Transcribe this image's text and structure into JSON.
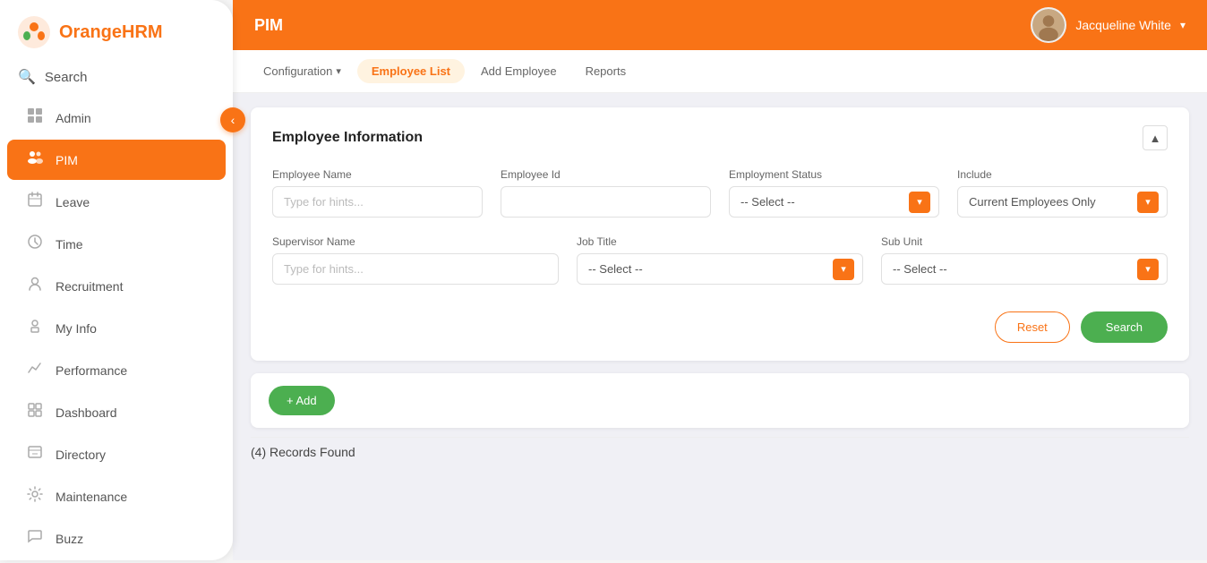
{
  "app": {
    "name": "OrangeHRM",
    "name_orange": "Orange",
    "name_hrm": "HRM"
  },
  "header": {
    "title": "PIM",
    "user_name": "Jacqueline White",
    "user_avatar": "👩"
  },
  "tabs": {
    "items": [
      {
        "id": "configuration",
        "label": "Configuration",
        "has_dropdown": true,
        "active": false
      },
      {
        "id": "employee-list",
        "label": "Employee List",
        "has_dropdown": false,
        "active": true
      },
      {
        "id": "add-employee",
        "label": "Add Employee",
        "has_dropdown": false,
        "active": false
      },
      {
        "id": "reports",
        "label": "Reports",
        "has_dropdown": false,
        "active": false
      }
    ]
  },
  "sidebar": {
    "search_label": "Search",
    "items": [
      {
        "id": "admin",
        "label": "Admin",
        "icon": "⊞"
      },
      {
        "id": "pim",
        "label": "PIM",
        "icon": "👥"
      },
      {
        "id": "leave",
        "label": "Leave",
        "icon": "🏷"
      },
      {
        "id": "time",
        "label": "Time",
        "icon": "⏱"
      },
      {
        "id": "recruitment",
        "label": "Recruitment",
        "icon": "👤"
      },
      {
        "id": "my-info",
        "label": "My Info",
        "icon": "🪪"
      },
      {
        "id": "performance",
        "label": "Performance",
        "icon": "📈"
      },
      {
        "id": "dashboard",
        "label": "Dashboard",
        "icon": "🏠"
      },
      {
        "id": "directory",
        "label": "Directory",
        "icon": "📋"
      },
      {
        "id": "maintenance",
        "label": "Maintenance",
        "icon": "⚙"
      },
      {
        "id": "buzz",
        "label": "Buzz",
        "icon": "💬"
      }
    ]
  },
  "employee_info": {
    "section_title": "Employee Information",
    "fields": {
      "employee_name_label": "Employee Name",
      "employee_name_placeholder": "Type for hints...",
      "employee_id_label": "Employee Id",
      "employee_id_placeholder": "",
      "employment_status_label": "Employment Status",
      "employment_status_placeholder": "-- Select --",
      "include_label": "Include",
      "include_value": "Current Employees Only",
      "supervisor_name_label": "Supervisor Name",
      "supervisor_name_placeholder": "Type for hints...",
      "job_title_label": "Job Title",
      "job_title_placeholder": "-- Select --",
      "sub_unit_label": "Sub Unit",
      "sub_unit_placeholder": "-- Select --"
    },
    "buttons": {
      "reset": "Reset",
      "search": "Search"
    }
  },
  "actions": {
    "add_button": "+ Add"
  },
  "results": {
    "records_found": "(4) Records Found"
  }
}
